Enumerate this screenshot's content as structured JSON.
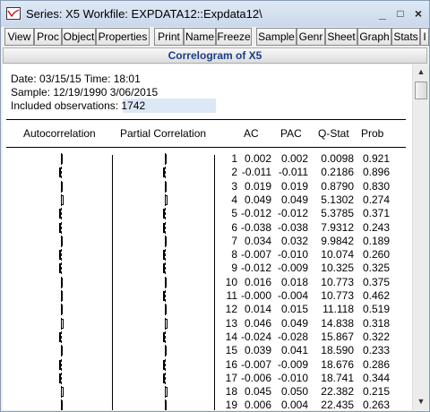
{
  "window": {
    "title": "Series: X5   Workfile: EXPDATA12::Expdata12\\",
    "minimize": "_",
    "restore": "□",
    "close": "×"
  },
  "toolbar": [
    "View",
    "Proc",
    "Object",
    "Properties",
    "Print",
    "Name",
    "Freeze",
    "Sample",
    "Genr",
    "Sheet",
    "Graph",
    "Stats",
    "I"
  ],
  "view_title": "Correlogram of X5",
  "header": {
    "date_line": "Date: 03/15/15   Time: 18:01",
    "sample_line": "Sample: 12/19/1990 3/06/2015",
    "obs_label": "Included observations: ",
    "obs_value": "1742"
  },
  "columns": {
    "ac_graph": "Autocorrelation",
    "pac_graph": "Partial Correlation",
    "ac": "AC",
    "pac": "PAC",
    "q": "Q-Stat",
    "prob": "Prob"
  },
  "rows": [
    {
      "lag": "1",
      "ac": "0.002",
      "pac": "0.002",
      "q": "0.0098",
      "prob": "0.921"
    },
    {
      "lag": "2",
      "ac": "-0.011",
      "pac": "-0.011",
      "q": "0.2186",
      "prob": "0.896"
    },
    {
      "lag": "3",
      "ac": "0.019",
      "pac": "0.019",
      "q": "0.8790",
      "prob": "0.830"
    },
    {
      "lag": "4",
      "ac": "0.049",
      "pac": "0.049",
      "q": "5.1302",
      "prob": "0.274"
    },
    {
      "lag": "5",
      "ac": "-0.012",
      "pac": "-0.012",
      "q": "5.3785",
      "prob": "0.371"
    },
    {
      "lag": "6",
      "ac": "-0.038",
      "pac": "-0.038",
      "q": "7.9312",
      "prob": "0.243"
    },
    {
      "lag": "7",
      "ac": "0.034",
      "pac": "0.032",
      "q": "9.9842",
      "prob": "0.189"
    },
    {
      "lag": "8",
      "ac": "-0.007",
      "pac": "-0.010",
      "q": "10.074",
      "prob": "0.260"
    },
    {
      "lag": "9",
      "ac": "-0.012",
      "pac": "-0.009",
      "q": "10.325",
      "prob": "0.325"
    },
    {
      "lag": "10",
      "ac": "0.016",
      "pac": "0.018",
      "q": "10.773",
      "prob": "0.375"
    },
    {
      "lag": "11",
      "ac": "-0.000",
      "pac": "-0.004",
      "q": "10.773",
      "prob": "0.462"
    },
    {
      "lag": "12",
      "ac": "0.014",
      "pac": "0.015",
      "q": "11.118",
      "prob": "0.519"
    },
    {
      "lag": "13",
      "ac": "0.046",
      "pac": "0.049",
      "q": "14.838",
      "prob": "0.318"
    },
    {
      "lag": "14",
      "ac": "-0.024",
      "pac": "-0.028",
      "q": "15.867",
      "prob": "0.322"
    },
    {
      "lag": "15",
      "ac": "0.039",
      "pac": "0.041",
      "q": "18.590",
      "prob": "0.233"
    },
    {
      "lag": "16",
      "ac": "-0.007",
      "pac": "-0.009",
      "q": "18.676",
      "prob": "0.286"
    },
    {
      "lag": "17",
      "ac": "-0.006",
      "pac": "-0.010",
      "q": "18.741",
      "prob": "0.344"
    },
    {
      "lag": "18",
      "ac": "0.045",
      "pac": "0.050",
      "q": "22.382",
      "prob": "0.215"
    },
    {
      "lag": "19",
      "ac": "0.006",
      "pac": "0.004",
      "q": "22.435",
      "prob": "0.263"
    }
  ],
  "scrollbar": {
    "up": "▲",
    "down": "▼"
  }
}
